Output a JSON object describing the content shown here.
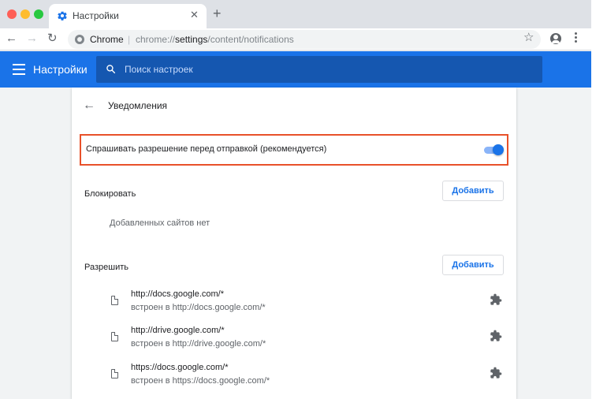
{
  "browser": {
    "tab_title": "Настройки",
    "new_tab_label": "+",
    "omnibox_scheme": "Chrome",
    "omnibox_sep": "|",
    "omnibox_url_prefix": "chrome://",
    "omnibox_url_bold": "settings",
    "omnibox_url_suffix": "/content/notifications"
  },
  "header": {
    "title": "Настройки",
    "search_placeholder": "Поиск настроек"
  },
  "page": {
    "title": "Уведомления",
    "ask_label": "Спрашивать разрешение перед отправкой (рекомендуется)",
    "ask_enabled": true
  },
  "block": {
    "title": "Блокировать",
    "add_label": "Добавить",
    "empty_text": "Добавленных сайтов нет"
  },
  "allow": {
    "title": "Разрешить",
    "add_label": "Добавить",
    "sites": [
      {
        "url": "http://docs.google.com/*",
        "sub": "встроен в http://docs.google.com/*"
      },
      {
        "url": "http://drive.google.com/*",
        "sub": "встроен в http://drive.google.com/*"
      },
      {
        "url": "https://docs.google.com/*",
        "sub": "встроен в https://docs.google.com/*"
      }
    ]
  },
  "colors": {
    "accent": "#1a73e8",
    "highlight_border": "#e8512a"
  }
}
